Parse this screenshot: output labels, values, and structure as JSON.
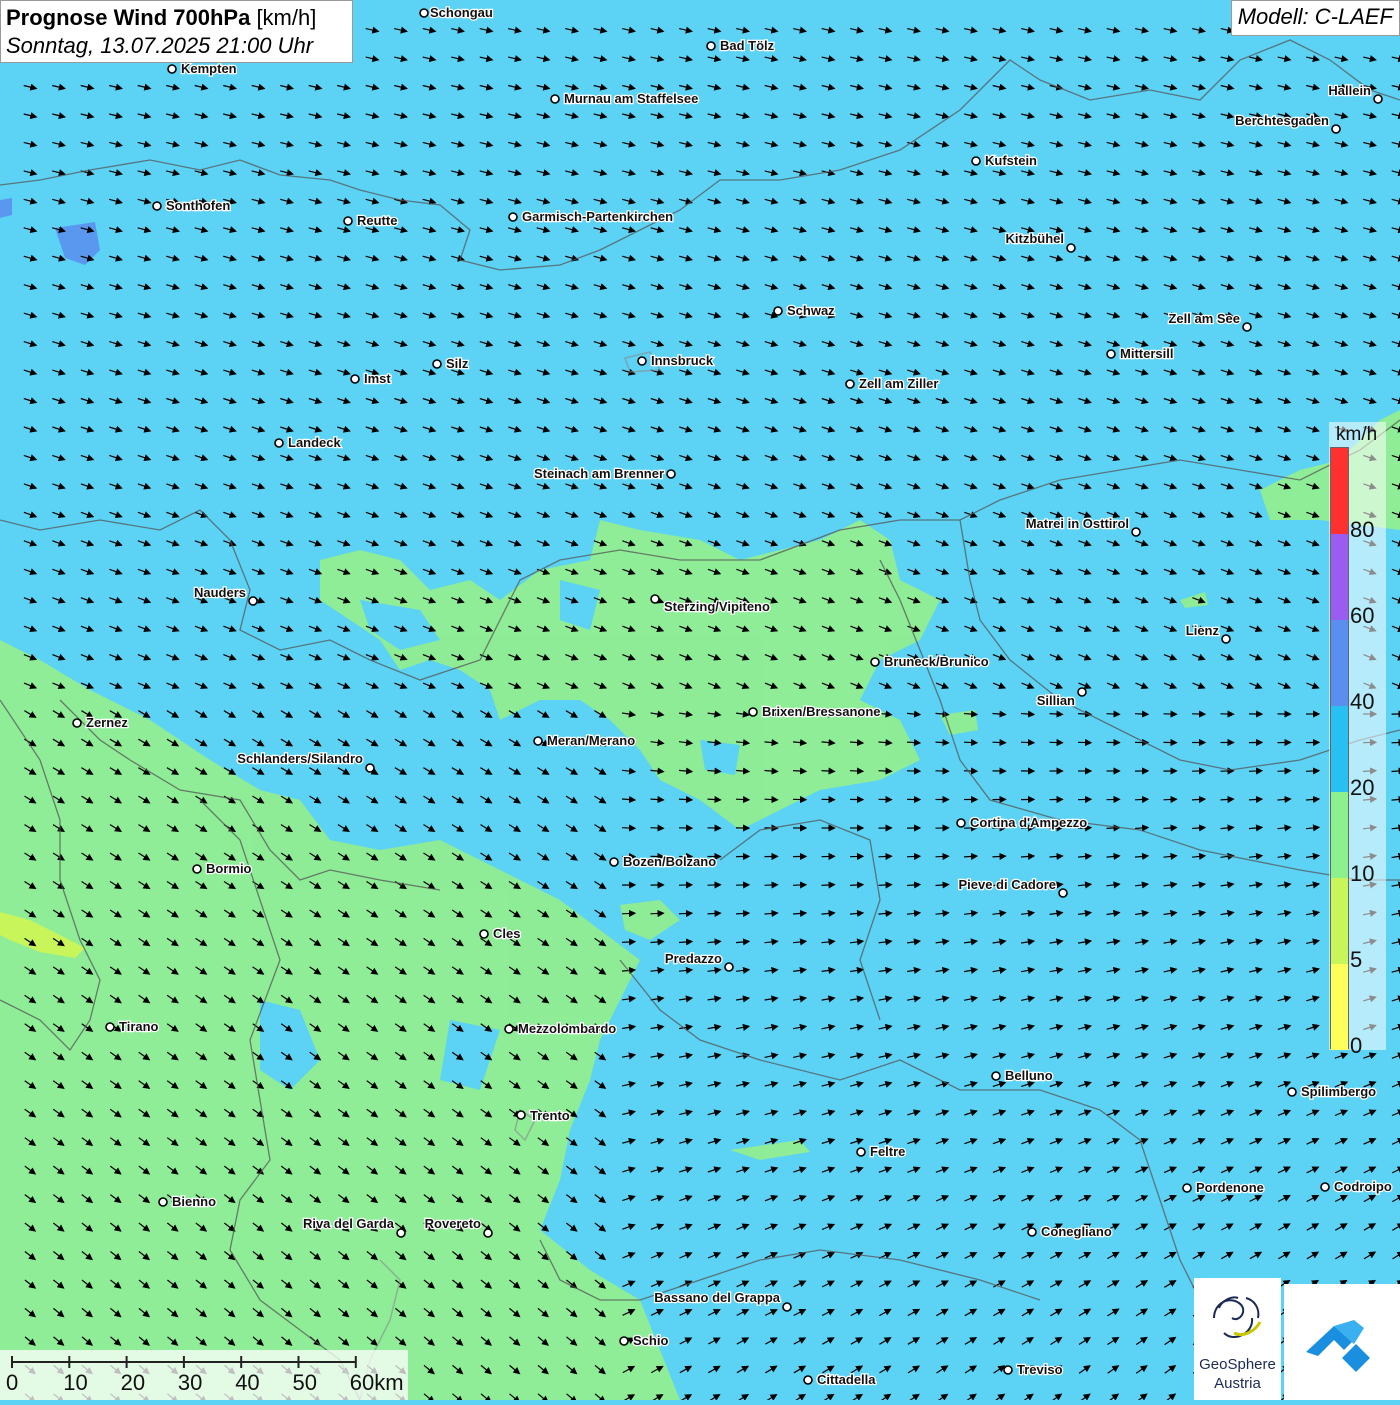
{
  "header": {
    "title_bold": "Prognose Wind 700hPa",
    "title_unit": "[km/h]",
    "subtitle": "Sonntag, 13.07.2025 21:00 Uhr",
    "model": "Modell: C-LAEF"
  },
  "legend": {
    "unit": "km/h",
    "classes": [
      {
        "color": "#ff3030"
      },
      {
        "color": "#9b5cf0"
      },
      {
        "color": "#5a8ff0"
      },
      {
        "color": "#28c0f2"
      },
      {
        "color": "#8cf08c"
      },
      {
        "color": "#c8f55a"
      },
      {
        "color": "#ffff5a"
      }
    ],
    "tick_labels": [
      "80",
      "60",
      "40",
      "20",
      "10",
      "5",
      "0"
    ]
  },
  "scale": {
    "labels": [
      "0",
      "10",
      "20",
      "30",
      "40",
      "50",
      "60km"
    ]
  },
  "logos": {
    "geosphere_name": "GeoSphere",
    "geosphere_sub": "Austria",
    "icon": "geosphere-logo-icon",
    "app_icon": "weather-app-logo-icon"
  },
  "colors": {
    "wind_10_20": "#5cd2f5",
    "wind_5_10": "#90ee90",
    "wind_0_5": "#c8f55a",
    "borders": "#555555"
  },
  "places": [
    {
      "name": "Schongau"
    },
    {
      "name": "Bad Tölz"
    },
    {
      "name": "Kempten"
    },
    {
      "name": "Murnau am Staffelsee"
    },
    {
      "name": "Hallein"
    },
    {
      "name": "Berchtesgaden"
    },
    {
      "name": "Kufstein"
    },
    {
      "name": "Sonthofen"
    },
    {
      "name": "Reutte"
    },
    {
      "name": "Garmisch-Partenkirchen"
    },
    {
      "name": "Kitzbühel"
    },
    {
      "name": "Schwaz"
    },
    {
      "name": "Zell am See"
    },
    {
      "name": "Mittersill"
    },
    {
      "name": "Innsbruck"
    },
    {
      "name": "Silz"
    },
    {
      "name": "Imst"
    },
    {
      "name": "Zell am Ziller"
    },
    {
      "name": "Landeck"
    },
    {
      "name": "Steinach am Brenner"
    },
    {
      "name": "Matrei in Osttirol"
    },
    {
      "name": "Nauders"
    },
    {
      "name": "Sterzing/Vipiteno"
    },
    {
      "name": "Lienz"
    },
    {
      "name": "Bruneck/Brunico"
    },
    {
      "name": "Sillian"
    },
    {
      "name": "Zernez"
    },
    {
      "name": "Brixen/Bressanone"
    },
    {
      "name": "Meran/Merano"
    },
    {
      "name": "Schlanders/Silandro"
    },
    {
      "name": "Cortina d'Ampezzo"
    },
    {
      "name": "Bormio"
    },
    {
      "name": "Bozen/Bolzano"
    },
    {
      "name": "Pieve di Cadore"
    },
    {
      "name": "Cles"
    },
    {
      "name": "Predazzo"
    },
    {
      "name": "Tirano"
    },
    {
      "name": "Mezzolombardo"
    },
    {
      "name": "Belluno"
    },
    {
      "name": "Spilimbergo"
    },
    {
      "name": "Trento"
    },
    {
      "name": "Feltre"
    },
    {
      "name": "Pordenone"
    },
    {
      "name": "Codroipo"
    },
    {
      "name": "Bienno"
    },
    {
      "name": "Riva del Garda"
    },
    {
      "name": "Rovereto"
    },
    {
      "name": "Conegliano"
    },
    {
      "name": "Bassano del Grappa"
    },
    {
      "name": "Schio"
    },
    {
      "name": "Treviso"
    },
    {
      "name": "Cittadella"
    }
  ]
}
